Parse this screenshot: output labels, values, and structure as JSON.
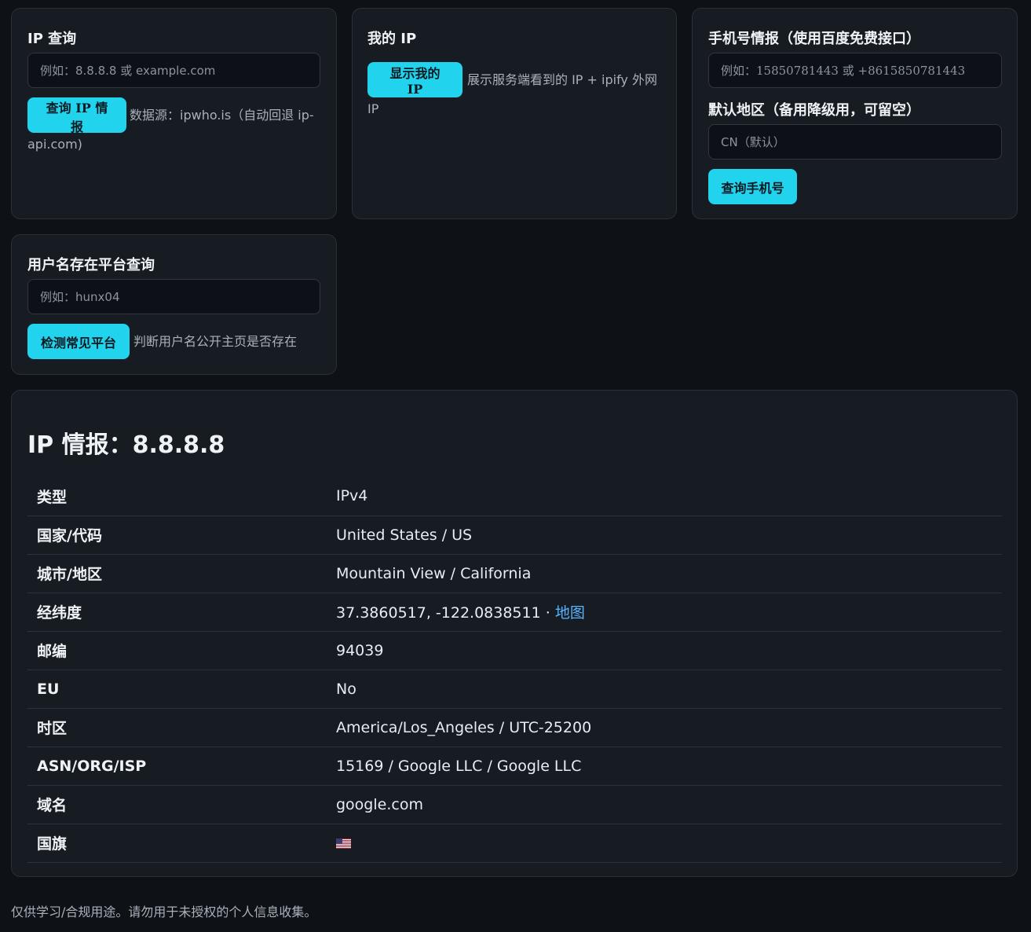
{
  "ip_card": {
    "title": "IP 查询",
    "placeholder": "例如：8.8.8.8 或 example.com",
    "button": "查询 IP 情报",
    "note": "数据源：ipwho.is（自动回退 ip-api.com)"
  },
  "myip_card": {
    "title": "我的 IP",
    "button": "显示我的 IP",
    "note": "展示服务端看到的 IP + ipify 外网 IP"
  },
  "phone_card": {
    "title": "手机号情报（使用百度免费接口）",
    "placeholder": "例如：15850781443 或 +8615850781443",
    "region_label": "默认地区（备用降级用，可留空）",
    "region_placeholder": "CN（默认）",
    "button": "查询手机号"
  },
  "user_card": {
    "title": "用户名存在平台查询",
    "placeholder": "例如：hunx04",
    "button": "检测常见平台",
    "note": "判断用户名公开主页是否存在"
  },
  "result": {
    "title": "IP 情报：8.8.8.8",
    "rows": [
      {
        "key": "类型",
        "value": "IPv4"
      },
      {
        "key": "国家/代码",
        "value": "United States / US"
      },
      {
        "key": "城市/地区",
        "value": "Mountain View / California"
      },
      {
        "key": "经纬度",
        "value": "37.3860517, -122.0838511 · "
      },
      {
        "key": "邮编",
        "value": "94039"
      },
      {
        "key": "EU",
        "value": "No"
      },
      {
        "key": "时区",
        "value": "America/Los_Angeles / UTC-25200"
      },
      {
        "key": "ASN/ORG/ISP",
        "value": "15169 / Google LLC / Google LLC"
      },
      {
        "key": "域名",
        "value": "google.com"
      },
      {
        "key": "国旗",
        "value": ""
      }
    ],
    "map_link": "地图",
    "flag_icon": "us-flag-icon"
  },
  "footer": "仅供学习/合规用途。请勿用于未授权的个人信息收集。",
  "colors": {
    "accent": "#22d3ee",
    "background": "#0e1116",
    "card": "#171b22",
    "link": "#58b4ff"
  }
}
